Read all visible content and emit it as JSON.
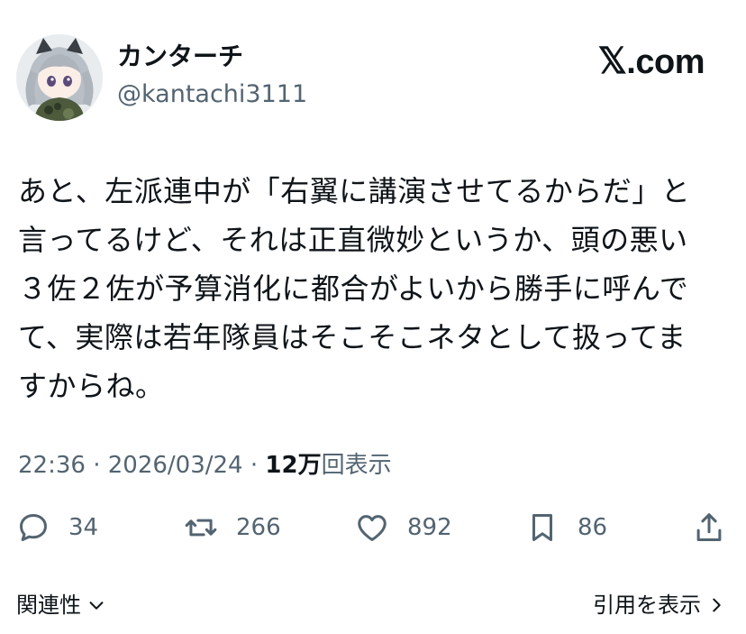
{
  "user": {
    "display_name": "カンターチ",
    "handle": "@kantachi3111"
  },
  "brand": {
    "mark": "𝕏",
    "domain": ".com"
  },
  "tweet": {
    "lines": [
      "あと、左派連中が「右翼に講演させてるからだ」と",
      "言ってるけど、それは正直微妙というか、頭の悪い",
      "３佐２佐が予算消化に都合がよいから勝手に呼んで",
      "て、実際は若年隊員はそこそこネタとして扱ってま",
      "すからね。"
    ]
  },
  "meta": {
    "time": "22:36",
    "sep1": " · ",
    "date": "2026/03/24",
    "sep2": " · ",
    "views_count": "12万",
    "views_label": "回表示"
  },
  "actions": {
    "replies": "34",
    "reposts": "266",
    "likes": "892",
    "bookmarks": "86"
  },
  "footer": {
    "related": "関連性",
    "quotes": "引用を表示"
  },
  "icons": {
    "reply": "reply-icon",
    "repost": "repost-icon",
    "like": "heart-icon",
    "bookmark": "bookmark-icon",
    "share": "share-icon"
  }
}
